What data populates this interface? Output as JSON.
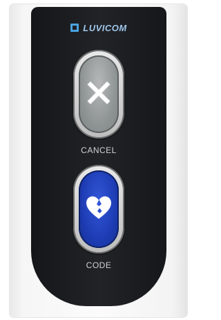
{
  "device": {
    "brand": "LUVICOM",
    "brand_logo_icon": "luvicom-logo-icon",
    "buttons": [
      {
        "label": "CANCEL",
        "icon": "x-icon",
        "color": "#8f9494"
      },
      {
        "label": "CODE",
        "icon": "broken-heart-icon",
        "color": "#1d3cb4"
      }
    ],
    "colors": {
      "faceplate": "#1c1d21",
      "housing": "#f5f5f5",
      "brand_text": "#9fc6ea",
      "code_button": "#1d3cb4",
      "cancel_button": "#8f9494"
    }
  }
}
